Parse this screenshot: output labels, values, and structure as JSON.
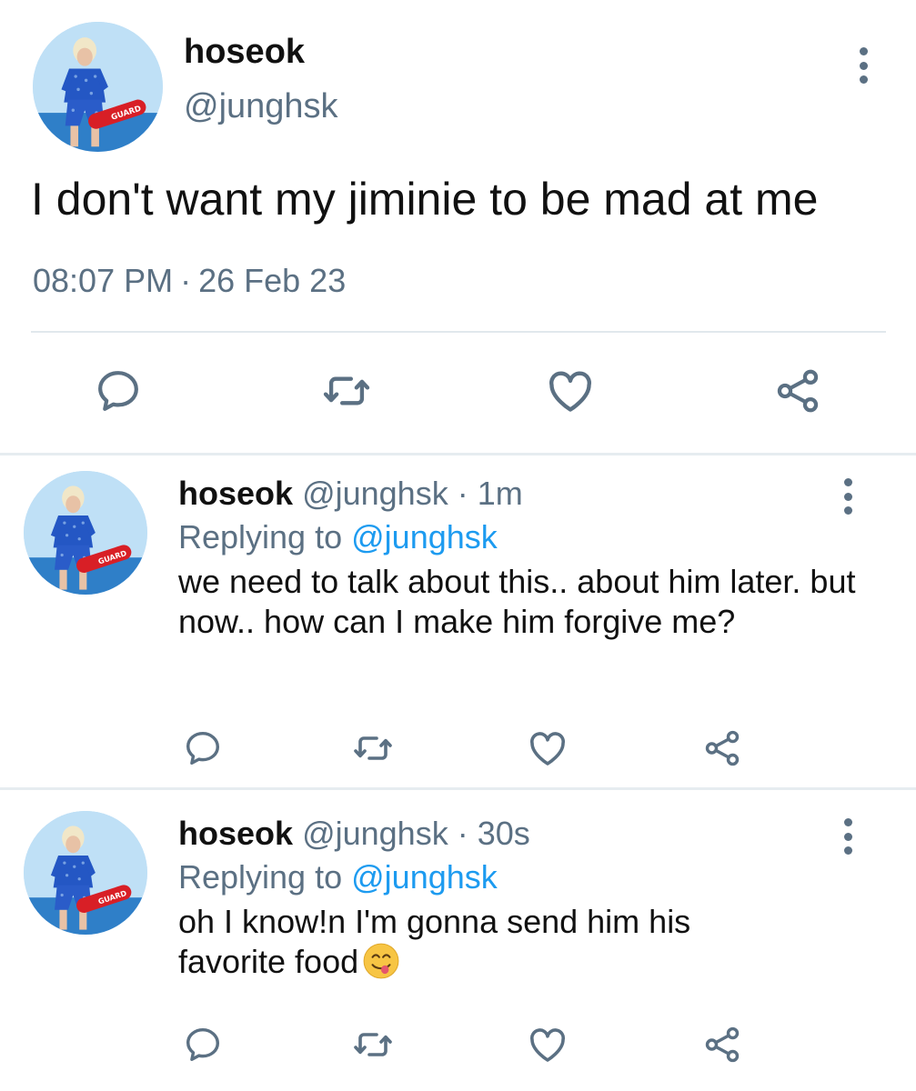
{
  "main_tweet": {
    "name": "hoseok",
    "handle": "@junghsk",
    "text": "I don't want my jiminie to be mad at me",
    "time": "08:07 PM",
    "separator": "·",
    "date": "26 Feb 23"
  },
  "avatar_badge": "GUARD",
  "replies": [
    {
      "name": "hoseok",
      "handle": "@junghsk",
      "dot": "·",
      "time": "1m",
      "replying_label": "Replying to",
      "replying_handle": "@junghsk",
      "text": "we need to talk about this.. about him later. but now.. how can I make him forgive me?"
    },
    {
      "name": "hoseok",
      "handle": "@junghsk",
      "dot": "·",
      "time": "30s",
      "replying_label": "Replying to",
      "replying_handle": "@junghsk",
      "text": "oh I know!n I'm gonna send him his favorite food",
      "emoji": "yum-face-emoji"
    }
  ],
  "icons": {
    "reply": "reply-icon",
    "retweet": "retweet-icon",
    "like": "heart-icon",
    "share": "share-icon",
    "more": "more-vertical-icon"
  },
  "colors": {
    "text": "#0f1419",
    "secondary": "#5b7083",
    "link": "#1d9bf0",
    "divider": "#e1e8ed"
  }
}
